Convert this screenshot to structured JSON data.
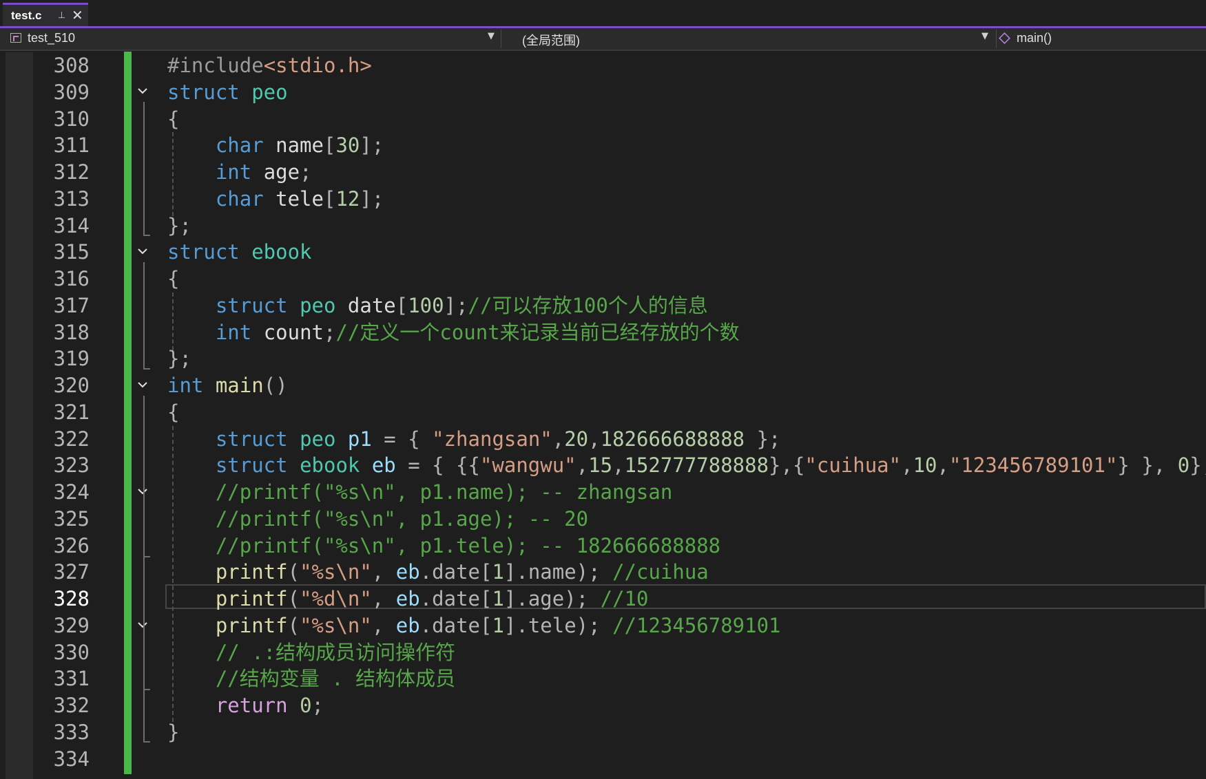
{
  "tab": {
    "title": "test.c",
    "pin_icon": "pin-icon",
    "close_icon": "close-icon"
  },
  "nav": {
    "project": "test_510",
    "scope": "(全局范围)",
    "function": "main()"
  },
  "lines": [
    {
      "n": "308",
      "tokens": [
        {
          "t": "#include",
          "c": "pp"
        },
        {
          "t": "<stdio.h>",
          "c": "st"
        }
      ]
    },
    {
      "n": "309",
      "tokens": [
        {
          "t": "struct ",
          "c": "kw"
        },
        {
          "t": "peo",
          "c": "ty"
        }
      ]
    },
    {
      "n": "310",
      "tokens": [
        {
          "t": "{",
          "c": "pn"
        }
      ]
    },
    {
      "n": "311",
      "tokens": [
        {
          "t": "    char ",
          "c": "kw"
        },
        {
          "t": "name",
          "c": ""
        },
        {
          "t": "[",
          "c": "pn"
        },
        {
          "t": "30",
          "c": "nm"
        },
        {
          "t": "];",
          "c": "pn"
        }
      ]
    },
    {
      "n": "312",
      "tokens": [
        {
          "t": "    int ",
          "c": "kw"
        },
        {
          "t": "age",
          "c": ""
        },
        {
          "t": ";",
          "c": "pn"
        }
      ]
    },
    {
      "n": "313",
      "tokens": [
        {
          "t": "    char ",
          "c": "kw"
        },
        {
          "t": "tele",
          "c": ""
        },
        {
          "t": "[",
          "c": "pn"
        },
        {
          "t": "12",
          "c": "nm"
        },
        {
          "t": "];",
          "c": "pn"
        }
      ]
    },
    {
      "n": "314",
      "tokens": [
        {
          "t": "};",
          "c": "pn"
        }
      ]
    },
    {
      "n": "315",
      "tokens": [
        {
          "t": "struct ",
          "c": "kw"
        },
        {
          "t": "ebook",
          "c": "ty"
        }
      ]
    },
    {
      "n": "316",
      "tokens": [
        {
          "t": "{",
          "c": "pn"
        }
      ]
    },
    {
      "n": "317",
      "tokens": [
        {
          "t": "    struct ",
          "c": "kw"
        },
        {
          "t": "peo ",
          "c": "ty"
        },
        {
          "t": "date",
          "c": ""
        },
        {
          "t": "[",
          "c": "pn"
        },
        {
          "t": "100",
          "c": "nm"
        },
        {
          "t": "];",
          "c": "pn"
        },
        {
          "t": "//可以存放100个人的信息",
          "c": "cm"
        }
      ]
    },
    {
      "n": "318",
      "tokens": [
        {
          "t": "    int ",
          "c": "kw"
        },
        {
          "t": "count",
          "c": ""
        },
        {
          "t": ";",
          "c": "pn"
        },
        {
          "t": "//定义一个count来记录当前已经存放的个数",
          "c": "cm"
        }
      ]
    },
    {
      "n": "319",
      "tokens": [
        {
          "t": "};",
          "c": "pn"
        }
      ]
    },
    {
      "n": "320",
      "tokens": [
        {
          "t": "int ",
          "c": "kw"
        },
        {
          "t": "main",
          "c": "fn"
        },
        {
          "t": "()",
          "c": "pn"
        }
      ]
    },
    {
      "n": "321",
      "tokens": [
        {
          "t": "{",
          "c": "pn"
        }
      ]
    },
    {
      "n": "322",
      "tokens": [
        {
          "t": "    struct ",
          "c": "kw"
        },
        {
          "t": "peo ",
          "c": "ty"
        },
        {
          "t": "p1",
          "c": "vr"
        },
        {
          "t": " = { ",
          "c": "pn"
        },
        {
          "t": "\"zhangsan\"",
          "c": "st"
        },
        {
          "t": ",",
          "c": "pn"
        },
        {
          "t": "20",
          "c": "nm"
        },
        {
          "t": ",",
          "c": "pn"
        },
        {
          "t": "182666688888",
          "c": "nm"
        },
        {
          "t": " };",
          "c": "pn"
        }
      ]
    },
    {
      "n": "323",
      "tokens": [
        {
          "t": "    struct ",
          "c": "kw"
        },
        {
          "t": "ebook ",
          "c": "ty"
        },
        {
          "t": "eb",
          "c": "vr"
        },
        {
          "t": " = { {{",
          "c": "pn"
        },
        {
          "t": "\"wangwu\"",
          "c": "st"
        },
        {
          "t": ",",
          "c": "pn"
        },
        {
          "t": "15",
          "c": "nm"
        },
        {
          "t": ",",
          "c": "pn"
        },
        {
          "t": "152777788888",
          "c": "nm"
        },
        {
          "t": "},{",
          "c": "pn"
        },
        {
          "t": "\"cuihua\"",
          "c": "st"
        },
        {
          "t": ",",
          "c": "pn"
        },
        {
          "t": "10",
          "c": "nm"
        },
        {
          "t": ",",
          "c": "pn"
        },
        {
          "t": "\"123456789101\"",
          "c": "st"
        },
        {
          "t": "} }, ",
          "c": "pn"
        },
        {
          "t": "0",
          "c": "nm"
        },
        {
          "t": "};",
          "c": "pn"
        }
      ]
    },
    {
      "n": "324",
      "tokens": [
        {
          "t": "    //printf(\"%s\\n\", p1.name); -- zhangsan",
          "c": "cm"
        }
      ]
    },
    {
      "n": "325",
      "tokens": [
        {
          "t": "    //printf(\"%s\\n\", p1.age); -- 20",
          "c": "cm"
        }
      ]
    },
    {
      "n": "326",
      "tokens": [
        {
          "t": "    //printf(\"%s\\n\", p1.tele); -- 182666688888",
          "c": "cm"
        }
      ]
    },
    {
      "n": "327",
      "tokens": [
        {
          "t": "    printf",
          "c": "fn"
        },
        {
          "t": "(",
          "c": "pn"
        },
        {
          "t": "\"%s\\n\"",
          "c": "st"
        },
        {
          "t": ", ",
          "c": "pn"
        },
        {
          "t": "eb",
          "c": "vr"
        },
        {
          "t": ".date[",
          "c": "pn"
        },
        {
          "t": "1",
          "c": "nm"
        },
        {
          "t": "].name); ",
          "c": "pn"
        },
        {
          "t": "//cuihua",
          "c": "cm"
        }
      ]
    },
    {
      "n": "328",
      "current": true,
      "tokens": [
        {
          "t": "    printf",
          "c": "fn"
        },
        {
          "t": "(",
          "c": "pn"
        },
        {
          "t": "\"%d\\n\"",
          "c": "st"
        },
        {
          "t": ", ",
          "c": "pn"
        },
        {
          "t": "eb",
          "c": "vr"
        },
        {
          "t": ".date[",
          "c": "pn"
        },
        {
          "t": "1",
          "c": "nm"
        },
        {
          "t": "].age); ",
          "c": "pn"
        },
        {
          "t": "//10",
          "c": "cm"
        }
      ]
    },
    {
      "n": "329",
      "tokens": [
        {
          "t": "    printf",
          "c": "fn"
        },
        {
          "t": "(",
          "c": "pn"
        },
        {
          "t": "\"%s\\n\"",
          "c": "st"
        },
        {
          "t": ", ",
          "c": "pn"
        },
        {
          "t": "eb",
          "c": "vr"
        },
        {
          "t": ".date[",
          "c": "pn"
        },
        {
          "t": "1",
          "c": "nm"
        },
        {
          "t": "].tele); ",
          "c": "pn"
        },
        {
          "t": "//123456789101",
          "c": "cm"
        }
      ]
    },
    {
      "n": "330",
      "tokens": [
        {
          "t": "    // .:结构成员访问操作符",
          "c": "cm"
        }
      ]
    },
    {
      "n": "331",
      "tokens": [
        {
          "t": "    //结构变量 . 结构体成员",
          "c": "cm"
        }
      ]
    },
    {
      "n": "332",
      "tokens": [
        {
          "t": "    return ",
          "c": "mv"
        },
        {
          "t": "0",
          "c": "nm"
        },
        {
          "t": ";",
          "c": "pn"
        }
      ]
    },
    {
      "n": "333",
      "tokens": [
        {
          "t": "}",
          "c": "pn"
        }
      ]
    },
    {
      "n": "334",
      "tokens": []
    }
  ]
}
